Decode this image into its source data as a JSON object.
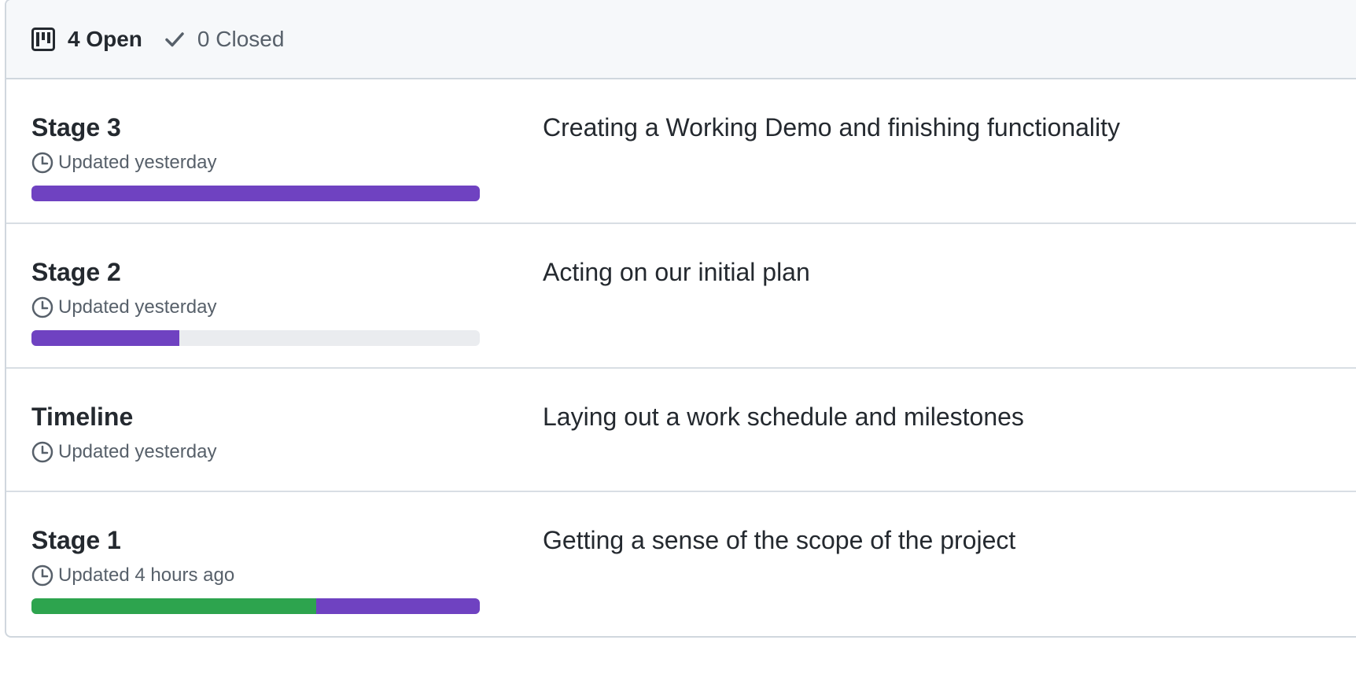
{
  "header": {
    "open_label": "4 Open",
    "closed_label": "0 Closed",
    "open_icon": "project-board-icon",
    "closed_icon": "check-icon"
  },
  "milestones": [
    {
      "title": "Stage 3",
      "updated": "Updated yesterday",
      "description": "Creating a Working Demo and finishing functionality",
      "progress": {
        "completed_fraction": 0.0,
        "in_progress_fraction": 1.0
      }
    },
    {
      "title": "Stage 2",
      "updated": "Updated yesterday",
      "description": "Acting on our initial plan",
      "progress": {
        "completed_fraction": 0.0,
        "in_progress_fraction": 0.33
      }
    },
    {
      "title": "Timeline",
      "updated": "Updated yesterday",
      "description": "Laying out a work schedule and milestones",
      "progress": null
    },
    {
      "title": "Stage 1",
      "updated": "Updated 4 hours ago",
      "description": "Getting a sense of the scope of the project",
      "progress": {
        "completed_fraction": 0.635,
        "in_progress_fraction": 0.365
      }
    }
  ],
  "colors": {
    "completed": "#2da44e",
    "in_progress": "#6f42c1",
    "track": "#eaecef"
  }
}
